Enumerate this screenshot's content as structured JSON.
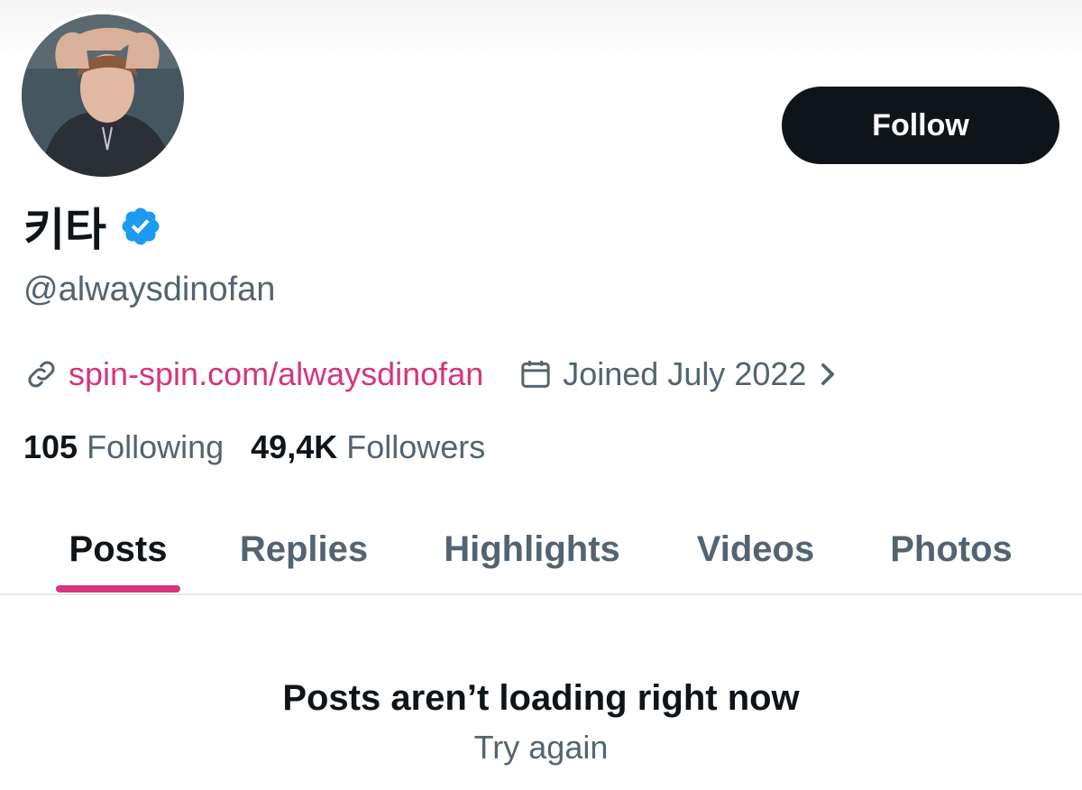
{
  "profile": {
    "display_name": "키타",
    "verified_icon": "verified-badge-icon",
    "handle": "@alwaysdinofan",
    "website": "spin-spin.com/alwaysdinofan",
    "joined": "Joined July 2022",
    "following_count": "105",
    "following_label": "Following",
    "followers_count": "49,4K",
    "followers_label": "Followers"
  },
  "actions": {
    "follow_label": "Follow"
  },
  "tabs": [
    {
      "label": "Posts",
      "active": true
    },
    {
      "label": "Replies",
      "active": false
    },
    {
      "label": "Highlights",
      "active": false
    },
    {
      "label": "Videos",
      "active": false
    },
    {
      "label": "Photos",
      "active": false
    }
  ],
  "feed": {
    "error_title": "Posts aren’t loading right now",
    "retry_label": "Try again"
  },
  "colors": {
    "accent": "#d6357a",
    "verified": "#1d9bf0",
    "primary_text": "#0f1419",
    "secondary_text": "#536471"
  }
}
